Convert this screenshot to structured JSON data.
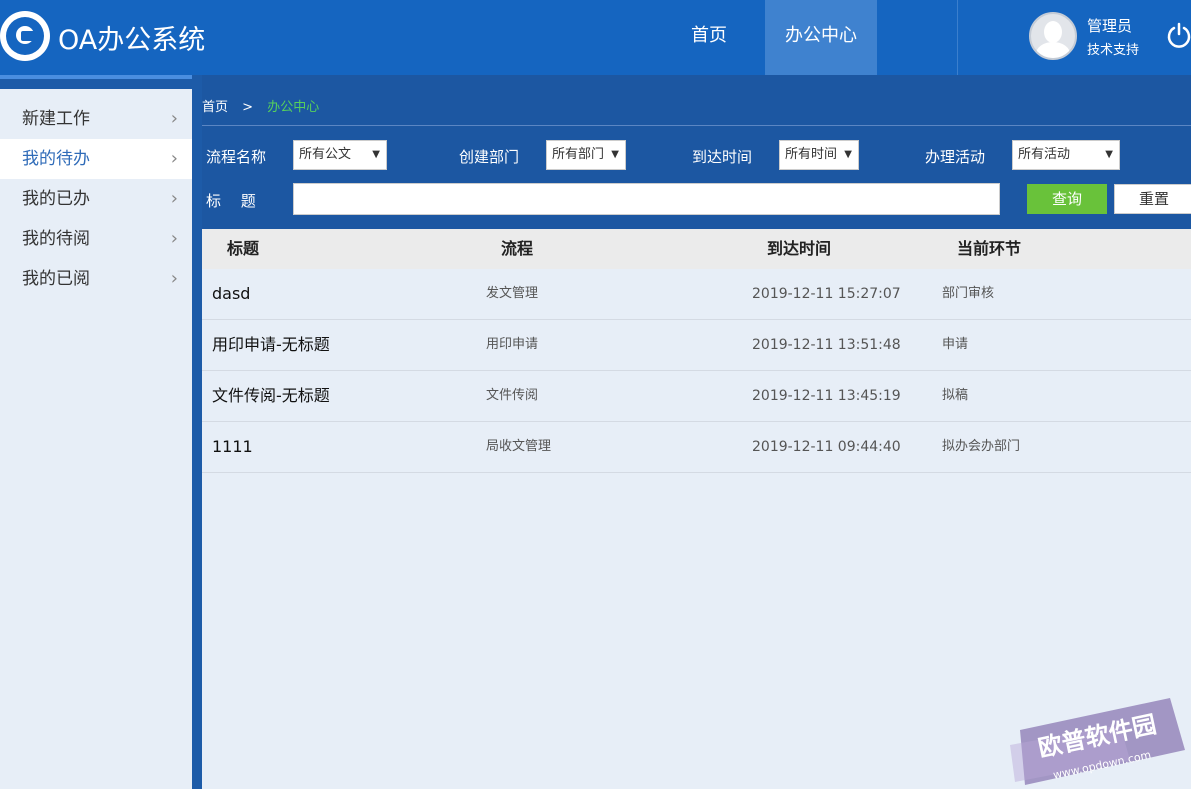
{
  "app": {
    "title": "OA办公系统"
  },
  "nav": {
    "items": [
      {
        "label": "首页"
      },
      {
        "label": "办公中心"
      }
    ]
  },
  "user": {
    "name": "管理员",
    "role": "技术支持"
  },
  "sidebar": {
    "items": [
      {
        "label": "新建工作"
      },
      {
        "label": "我的待办"
      },
      {
        "label": "我的已办"
      },
      {
        "label": "我的待阅"
      },
      {
        "label": "我的已阅"
      }
    ]
  },
  "breadcrumb": {
    "home": "首页",
    "sep": ">",
    "current": "办公中心"
  },
  "filters": {
    "flow": {
      "label": "流程名称",
      "value": "所有公文"
    },
    "dept": {
      "label": "创建部门",
      "value": "所有部门"
    },
    "time": {
      "label": "到达时间",
      "value": "所有时间"
    },
    "activity": {
      "label": "办理活动",
      "value": "所有活动"
    },
    "title": {
      "label": "标　 题",
      "value": ""
    },
    "query_label": "查询",
    "reset_label": "重置"
  },
  "table": {
    "headers": [
      "标题",
      "流程",
      "到达时间",
      "当前环节"
    ],
    "rows": [
      {
        "title": "dasd",
        "flow": "发文管理",
        "time": "2019-12-11 15:27:07",
        "step": "部门审核"
      },
      {
        "title": "用印申请-无标题",
        "flow": "用印申请",
        "time": "2019-12-11 13:51:48",
        "step": "申请"
      },
      {
        "title": "文件传阅-无标题",
        "flow": "文件传阅",
        "time": "2019-12-11 13:45:19",
        "step": "拟稿"
      },
      {
        "title": "1111",
        "flow": "局收文管理",
        "time": "2019-12-11 09:44:40",
        "step": "拟办会办部门"
      }
    ]
  },
  "watermark": {
    "text": "欧普软件园",
    "url": "www.opdown.com"
  },
  "colors": {
    "header": "#1565c0",
    "accent_green": "#69c23a",
    "active_link": "#2f6bb8",
    "panel": "#1c57a2"
  }
}
